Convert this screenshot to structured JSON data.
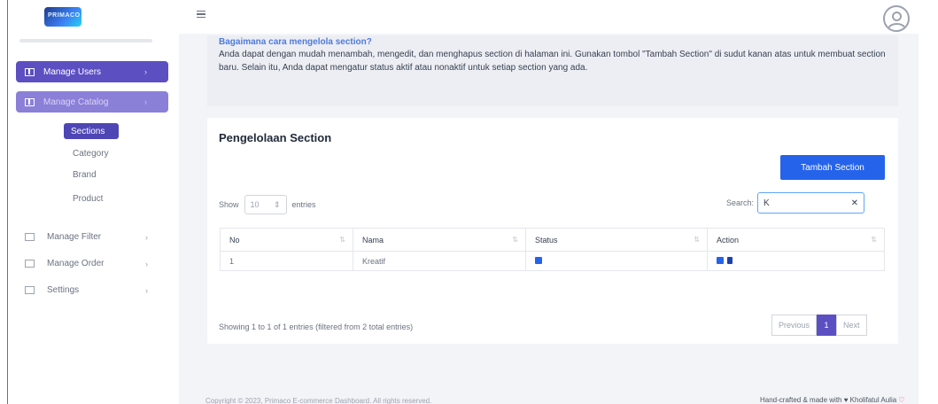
{
  "brand": {
    "logo_text": "PRIMACO"
  },
  "sidebar": {
    "manage_users": "Manage Users",
    "manage_catalog": "Manage Catalog",
    "sub_items": [
      "Sections",
      "Category",
      "Brand",
      "Product"
    ],
    "manage_filter": "Manage Filter",
    "manage_order": "Manage Order",
    "settings": "Settings",
    "arrow": "›"
  },
  "info": {
    "title": "Bagaimana cara mengelola section?",
    "text": "Anda dapat dengan mudah menambah, mengedit, dan menghapus section di halaman ini. Gunakan tombol \"Tambah Section\" di sudut kanan atas untuk membuat section baru. Selain itu, Anda dapat mengatur status aktif atau nonaktif untuk setiap section yang ada."
  },
  "card": {
    "title": "Pengelolaan Section",
    "add_button": "Tambah Section",
    "show_label": "Show",
    "show_value": "10",
    "entries_label": "entries",
    "search_label": "Search:",
    "search_value": "K",
    "clear": "✕"
  },
  "table": {
    "headers": [
      "No",
      "Nama",
      "Status",
      "Action"
    ],
    "rows": [
      {
        "no": "1",
        "nama": "Kreatif"
      }
    ]
  },
  "pagination": {
    "showing": "Showing 1 to 1 of 1 entries (filtered from 2 total entries)",
    "previous": "Previous",
    "current": "1",
    "next": "Next"
  },
  "footer": {
    "copyright": "Copyright © 2023, Primaco E-commerce Dashboard. All rights reserved.",
    "credit": "Hand-crafted & made with ♥ Kholifatul Aulia",
    "heart": "♡"
  },
  "colors": {
    "primary": "#5b4fc2",
    "accent": "#2563eb",
    "background": "#f3f4f7"
  }
}
